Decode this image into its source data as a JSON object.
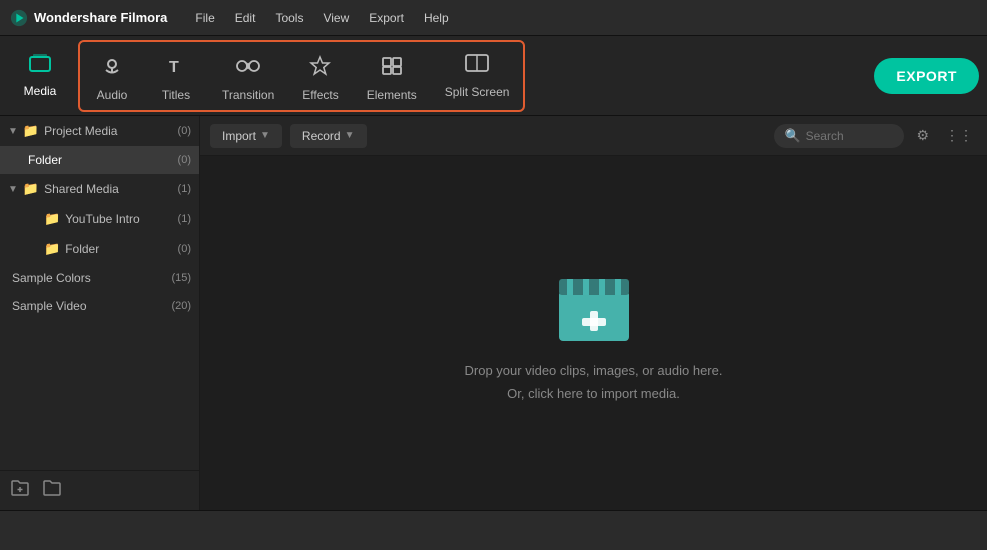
{
  "app": {
    "title": "Wondershare Filmora",
    "logo": "🎬"
  },
  "menu": {
    "items": [
      "File",
      "Edit",
      "Tools",
      "View",
      "Export",
      "Help"
    ]
  },
  "toolbar": {
    "media_label": "Media",
    "audio_label": "Audio",
    "titles_label": "Titles",
    "transition_label": "Transition",
    "effects_label": "Effects",
    "elements_label": "Elements",
    "splitscreen_label": "Split Screen",
    "export_label": "EXPORT"
  },
  "content_toolbar": {
    "import_label": "Import",
    "record_label": "Record",
    "search_placeholder": "Search"
  },
  "sidebar": {
    "sections": [
      {
        "id": "project-media",
        "label": "Project Media",
        "count": "(0)",
        "indent": 0,
        "has_arrow": true,
        "selected": false
      },
      {
        "id": "folder",
        "label": "Folder",
        "count": "(0)",
        "indent": 1,
        "has_arrow": false,
        "selected": true
      },
      {
        "id": "shared-media",
        "label": "Shared Media",
        "count": "(1)",
        "indent": 0,
        "has_arrow": true,
        "selected": false
      },
      {
        "id": "youtube-intro",
        "label": "YouTube Intro",
        "count": "(1)",
        "indent": 2,
        "has_arrow": false,
        "selected": false
      },
      {
        "id": "folder2",
        "label": "Folder",
        "count": "(0)",
        "indent": 2,
        "has_arrow": false,
        "selected": false
      },
      {
        "id": "sample-colors",
        "label": "Sample Colors",
        "count": "(15)",
        "indent": 0,
        "has_arrow": false,
        "selected": false
      },
      {
        "id": "sample-video",
        "label": "Sample Video",
        "count": "(20)",
        "indent": 0,
        "has_arrow": false,
        "selected": false
      }
    ]
  },
  "drop_zone": {
    "line1": "Drop your video clips, images, or audio here.",
    "line2": "Or, click here to import media."
  },
  "colors": {
    "accent": "#00c4a0",
    "badge": "#e74c3c",
    "toolbar_border": "#e05c30",
    "selected_bg": "#3a3a3a"
  }
}
